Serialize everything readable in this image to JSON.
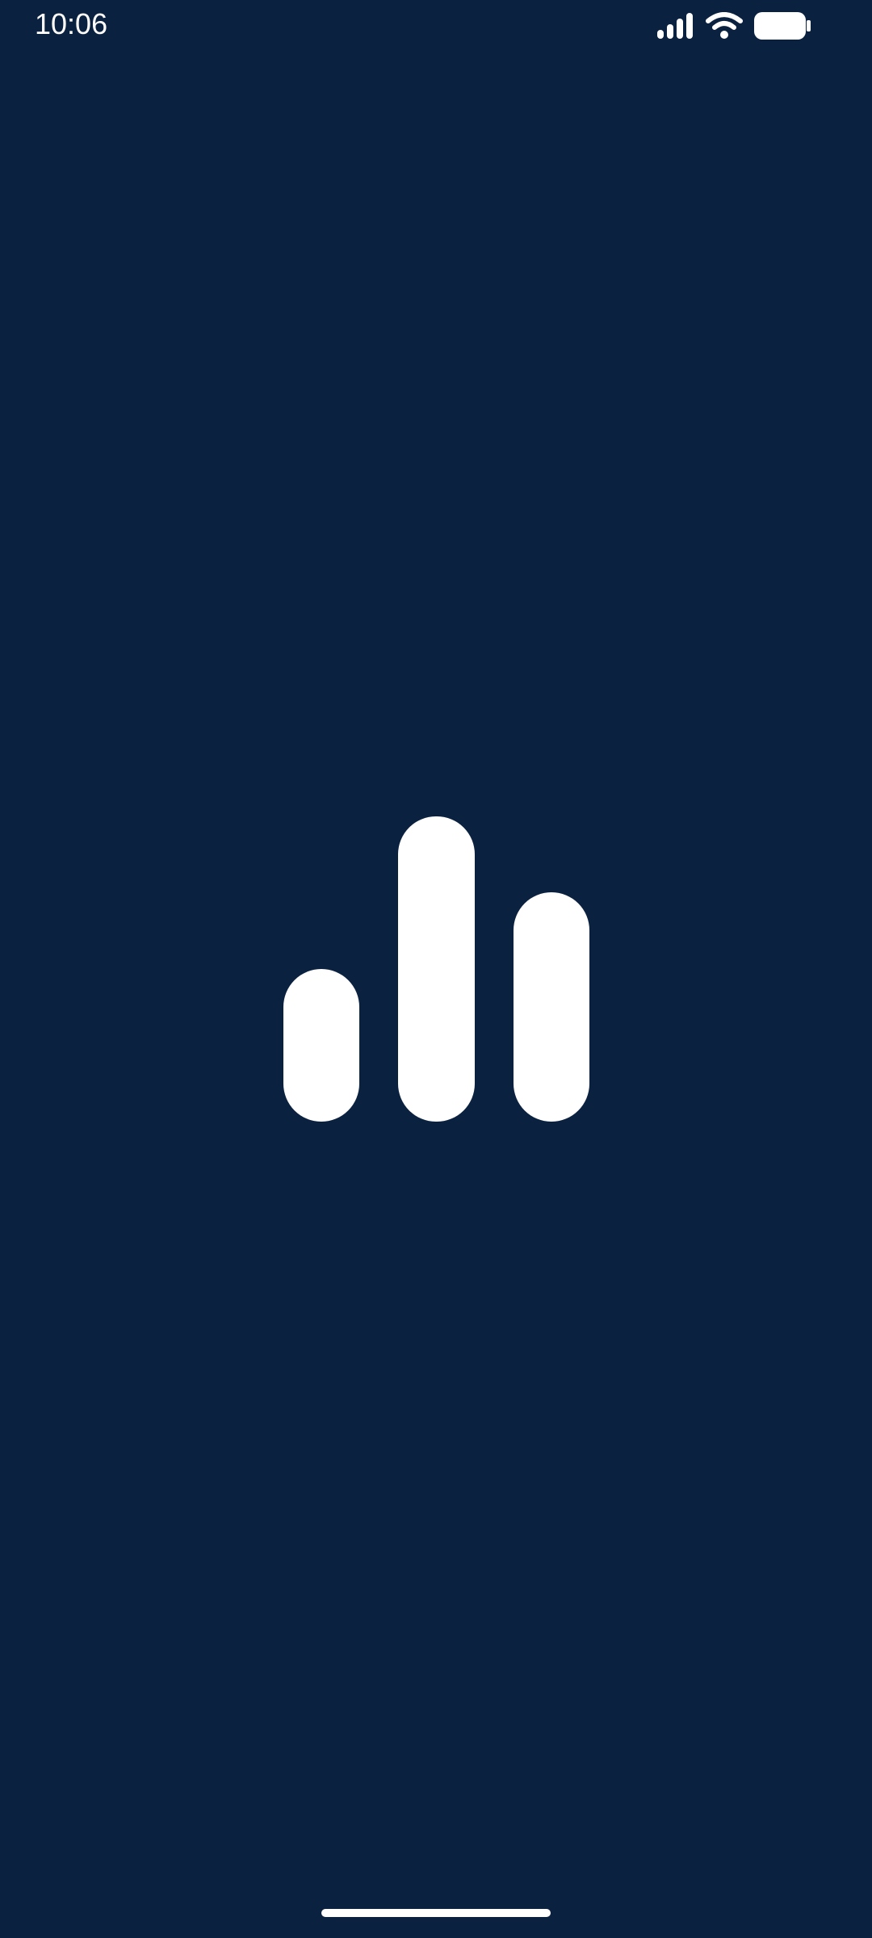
{
  "status_bar": {
    "time": "10:06",
    "icons": [
      "signal-icon",
      "wifi-icon",
      "battery-icon"
    ]
  },
  "splash": {
    "logo_icon": "bar-chart-logo-icon"
  },
  "colors": {
    "background": "#0b2140",
    "foreground": "#ffffff"
  }
}
